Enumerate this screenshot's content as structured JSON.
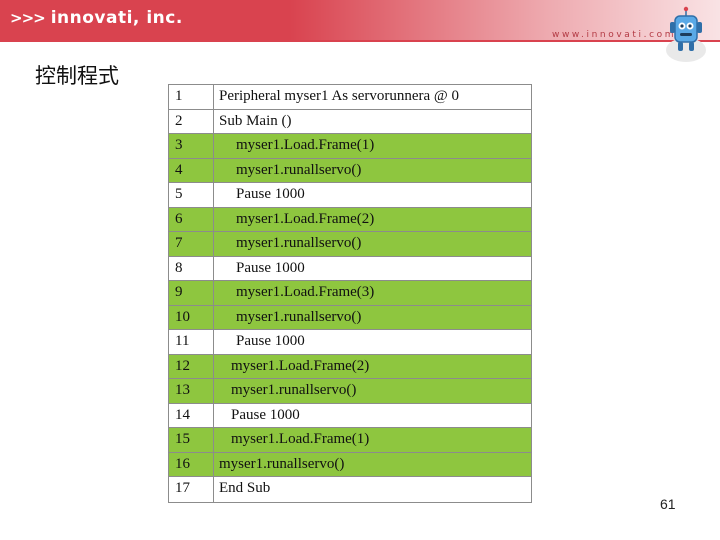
{
  "header": {
    "brand_prefix": ">>>",
    "brand": "innovati, inc.",
    "url": "www.innovati.com.tw",
    "brand_color": "#d9434f"
  },
  "slide": {
    "title": "控制程式",
    "page_number": "61"
  },
  "code_lines": [
    {
      "num": "1",
      "text": "Peripheral myser1 As servorunnera @ 0",
      "indent": 0,
      "highlight": false
    },
    {
      "num": "2",
      "text": "Sub Main ()",
      "indent": 0,
      "highlight": false
    },
    {
      "num": "3",
      "text": "myser1.Load.Frame(1)",
      "indent": 2,
      "highlight": true
    },
    {
      "num": "4",
      "text": "myser1.runallservo()",
      "indent": 2,
      "highlight": true
    },
    {
      "num": "5",
      "text": "Pause 1000",
      "indent": 2,
      "highlight": false
    },
    {
      "num": "6",
      "text": "myser1.Load.Frame(2)",
      "indent": 2,
      "highlight": true
    },
    {
      "num": "7",
      "text": "myser1.runallservo()",
      "indent": 2,
      "highlight": true
    },
    {
      "num": "8",
      "text": "Pause 1000",
      "indent": 2,
      "highlight": false
    },
    {
      "num": "9",
      "text": "myser1.Load.Frame(3)",
      "indent": 2,
      "highlight": true
    },
    {
      "num": "10",
      "text": "myser1.runallservo()",
      "indent": 2,
      "highlight": true
    },
    {
      "num": "11",
      "text": "Pause 1000",
      "indent": 2,
      "highlight": false
    },
    {
      "num": "12",
      "text": "myser1.Load.Frame(2)",
      "indent": 1,
      "highlight": true
    },
    {
      "num": "13",
      "text": "myser1.runallservo()",
      "indent": 1,
      "highlight": true
    },
    {
      "num": "14",
      "text": "Pause 1000",
      "indent": 1,
      "highlight": false
    },
    {
      "num": "15",
      "text": "myser1.Load.Frame(1)",
      "indent": 1,
      "highlight": true
    },
    {
      "num": "16",
      "text": "myser1.runallservo()",
      "indent": 0,
      "highlight": true
    },
    {
      "num": "17",
      "text": "End Sub",
      "indent": 0,
      "highlight": false
    }
  ],
  "colors": {
    "highlight": "#8ec63f",
    "border": "#8c8c8c"
  },
  "icons": {
    "logo": "chevron-arrows-icon",
    "mascot": "robot-icon"
  }
}
